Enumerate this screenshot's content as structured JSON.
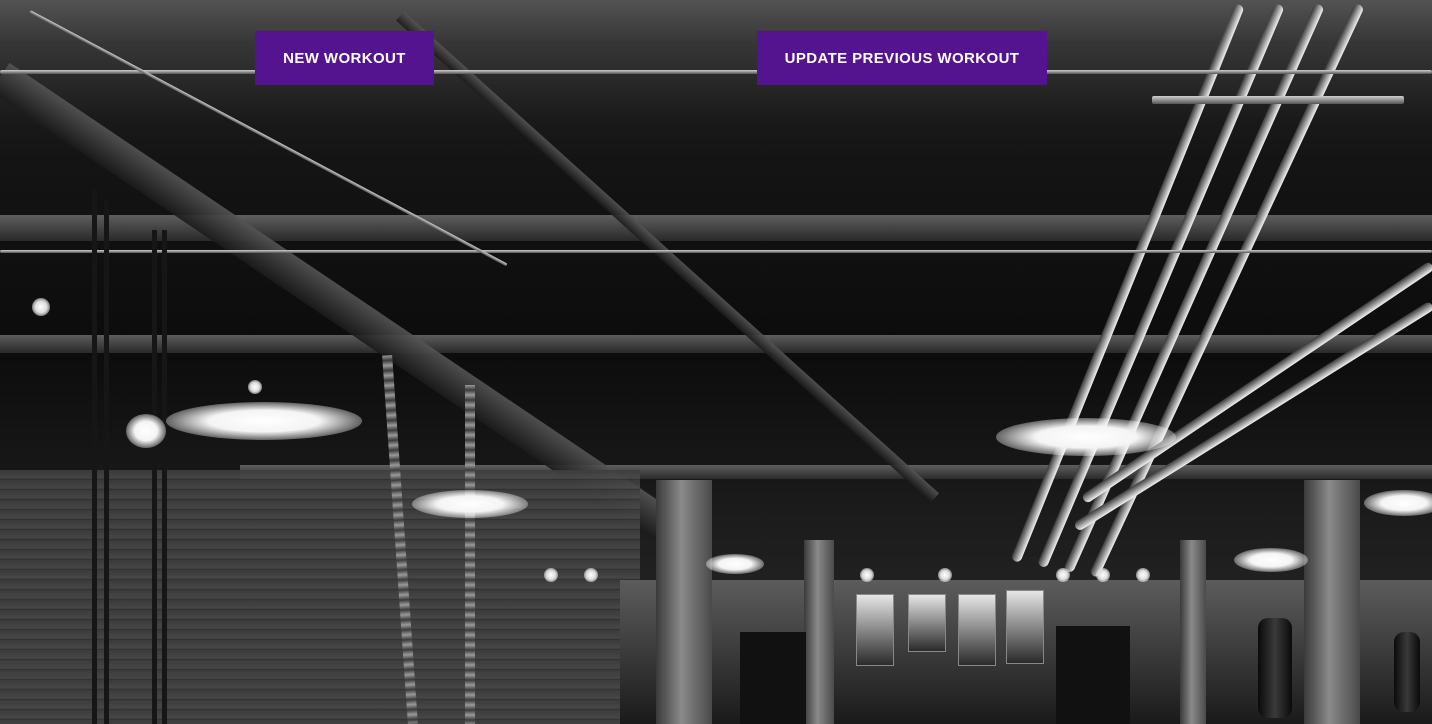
{
  "actions": {
    "new_workout_label": "NEW WORKOUT",
    "update_previous_workout_label": "UPDATE PREVIOUS WORKOUT"
  },
  "colors": {
    "button_background": "#54148f",
    "button_text": "#ffffff"
  },
  "background": {
    "subject": "gym-interior-photo",
    "tone": "grayscale"
  }
}
